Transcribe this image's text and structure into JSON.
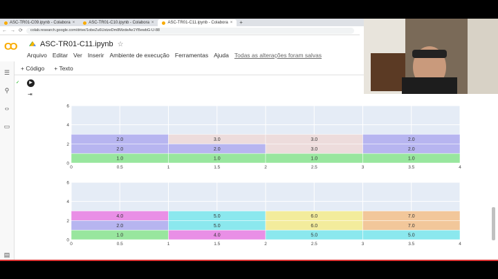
{
  "browser": {
    "tabs": [
      {
        "label": "ASC-TR01-C09.ipynb - Colabora"
      },
      {
        "label": "ASC-TR01-C10.ipynb - Colabora"
      },
      {
        "label": "ASC-TR01-C11.ipynb - Colabora"
      }
    ],
    "url": "colab.research.google.com/drive/1obeZu6UstzeDm8MzdeAe1YBewbG-U-88"
  },
  "colab": {
    "logo": "CO",
    "notebook_title": "ASC-TR01-C11.ipynb",
    "menu": [
      "Arquivo",
      "Editar",
      "Ver",
      "Inserir",
      "Ambiente de execução",
      "Ferramentas",
      "Ajuda"
    ],
    "saved_status": "Todas as alterações foram salvas",
    "toolbar": {
      "add_code": "+ Código",
      "add_text": "+ Texto"
    }
  },
  "chart_data": [
    {
      "type": "bar",
      "orientation": "horizontal-stacked",
      "xlim": [
        0,
        4
      ],
      "ylim": [
        0,
        6
      ],
      "x_ticks": [
        "0",
        "0.5",
        "1",
        "1.5",
        "2",
        "2.5",
        "3",
        "3.5",
        "4"
      ],
      "y_ticks": [
        "0",
        "2",
        "4",
        "6"
      ],
      "segments": [
        {
          "x0": 0,
          "x1": 1,
          "row": 0,
          "label": "1.0",
          "color": "#98e69e"
        },
        {
          "x0": 1,
          "x1": 2,
          "row": 0,
          "label": "1.0",
          "color": "#98e69e"
        },
        {
          "x0": 2,
          "x1": 3,
          "row": 0,
          "label": "1.0",
          "color": "#98e69e"
        },
        {
          "x0": 3,
          "x1": 4,
          "row": 0,
          "label": "1.0",
          "color": "#98e69e"
        },
        {
          "x0": 0,
          "x1": 1,
          "row": 1,
          "label": "2.0",
          "color": "#b7b5f0"
        },
        {
          "x0": 1,
          "x1": 2,
          "row": 1,
          "label": "2.0",
          "color": "#b7b5f0"
        },
        {
          "x0": 2,
          "x1": 3,
          "row": 1,
          "label": "3.0",
          "color": "#eddcdc"
        },
        {
          "x0": 3,
          "x1": 4,
          "row": 1,
          "label": "2.0",
          "color": "#b7b5f0"
        },
        {
          "x0": 0,
          "x1": 1,
          "row": 2,
          "label": "2.0",
          "color": "#b7b5f0"
        },
        {
          "x0": 1,
          "x1": 2,
          "row": 2,
          "label": "3.0",
          "color": "#eddcdc"
        },
        {
          "x0": 2,
          "x1": 3,
          "row": 2,
          "label": "3.0",
          "color": "#eddcdc"
        },
        {
          "x0": 3,
          "x1": 4,
          "row": 2,
          "label": "2.0",
          "color": "#b7b5f0"
        }
      ]
    },
    {
      "type": "bar",
      "orientation": "horizontal-stacked",
      "xlim": [
        0,
        4
      ],
      "ylim": [
        0,
        6
      ],
      "x_ticks": [
        "0",
        "0.5",
        "1",
        "1.5",
        "2",
        "2.5",
        "3",
        "3.5",
        "4"
      ],
      "y_ticks": [
        "0",
        "2",
        "4",
        "6"
      ],
      "segments": [
        {
          "x0": 0,
          "x1": 1,
          "row": 0,
          "label": "1.0",
          "color": "#98e69e"
        },
        {
          "x0": 1,
          "x1": 2,
          "row": 0,
          "label": "4.0",
          "color": "#e98fe6"
        },
        {
          "x0": 2,
          "x1": 3,
          "row": 0,
          "label": "5.0",
          "color": "#8be8ee"
        },
        {
          "x0": 3,
          "x1": 4,
          "row": 0,
          "label": "5.0",
          "color": "#8be8ee"
        },
        {
          "x0": 0,
          "x1": 1,
          "row": 1,
          "label": "2.0",
          "color": "#b7b5f0"
        },
        {
          "x0": 1,
          "x1": 2,
          "row": 1,
          "label": "5.0",
          "color": "#8be8ee"
        },
        {
          "x0": 2,
          "x1": 3,
          "row": 1,
          "label": "6.0",
          "color": "#f3ec9c"
        },
        {
          "x0": 3,
          "x1": 4,
          "row": 1,
          "label": "7.0",
          "color": "#f2c79a"
        },
        {
          "x0": 0,
          "x1": 1,
          "row": 2,
          "label": "4.0",
          "color": "#e98fe6"
        },
        {
          "x0": 1,
          "x1": 2,
          "row": 2,
          "label": "5.0",
          "color": "#8be8ee"
        },
        {
          "x0": 2,
          "x1": 3,
          "row": 2,
          "label": "6.0",
          "color": "#f3ec9c"
        },
        {
          "x0": 3,
          "x1": 4,
          "row": 2,
          "label": "7.0",
          "color": "#f2c79a"
        }
      ]
    }
  ]
}
